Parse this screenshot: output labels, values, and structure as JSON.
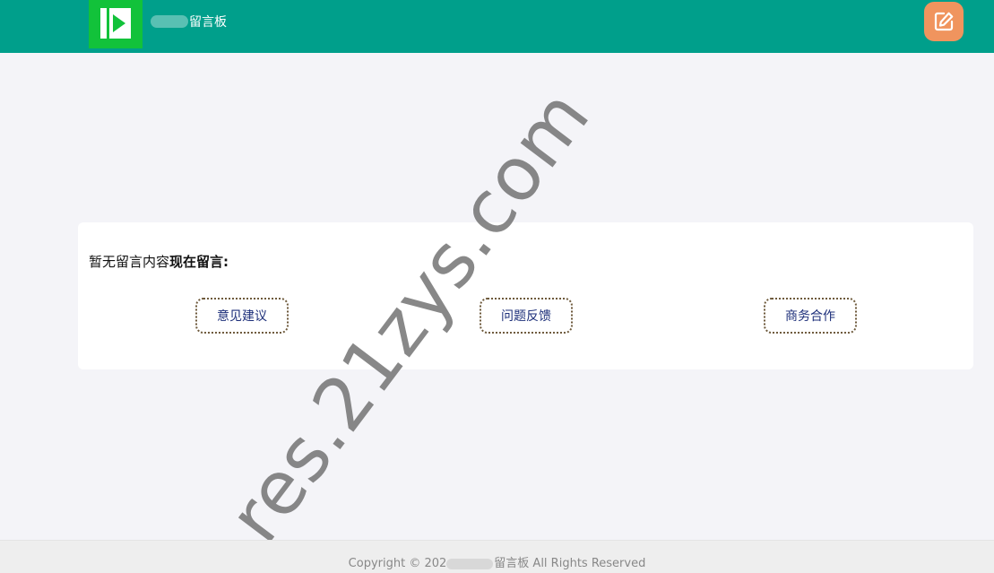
{
  "header": {
    "site_name": "留言板",
    "logo": "logo-icon",
    "edit_icon": "edit-icon",
    "colors": {
      "bar": "#009f8b",
      "logo": "#12c23a",
      "edit_button": "#f0945e"
    }
  },
  "main": {
    "empty_text": "暂无留言内容",
    "cta_text": "现在留言:",
    "categories": [
      {
        "label": "意见建议"
      },
      {
        "label": "问题反馈"
      },
      {
        "label": "商务合作"
      }
    ]
  },
  "watermark": "res.21zys.com",
  "footer": {
    "copyright_prefix": "Copyright © 202",
    "copyright_site": "留言板",
    "copyright_suffix": " All Rights Reserved"
  }
}
